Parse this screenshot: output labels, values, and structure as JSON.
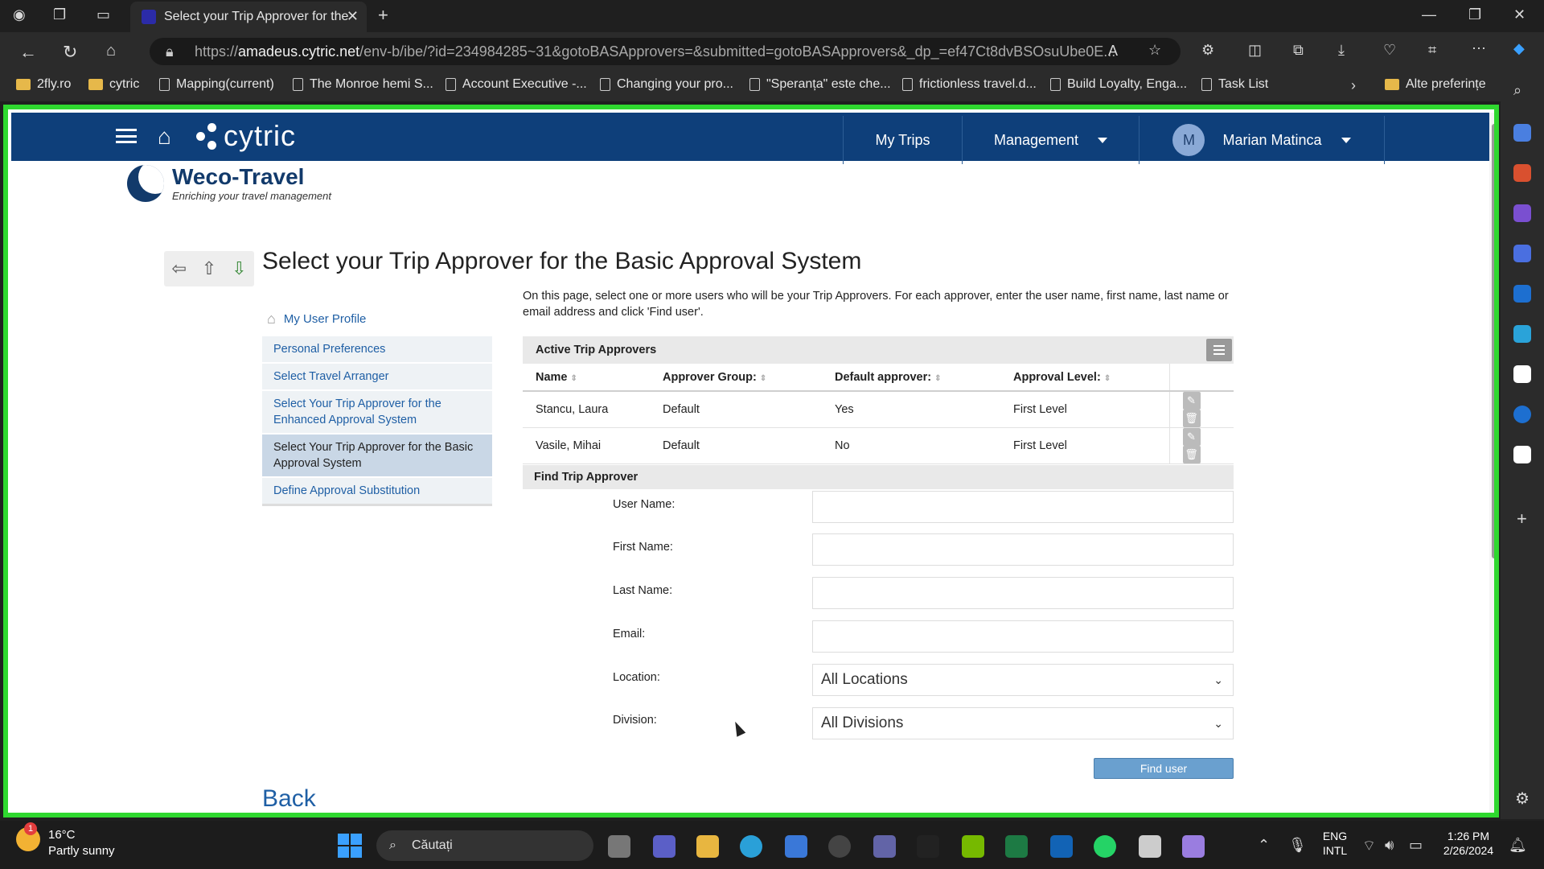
{
  "browser": {
    "tab_title": "Select your Trip Approver for the",
    "url_host": "amadeus.cytric.net",
    "url_rest": "/env-b/ibe/?id=234984285~31&gotoBASApprovers=&submitted=gotoBASApprovers&_dp_=ef47Ct8dvBSOsuUbe0E...",
    "url_prefix": "https://",
    "bookmarks": [
      "2fly.ro",
      "cytric",
      "Mapping(current)",
      "The Monroe hemi S...",
      "Account Executive -...",
      "Changing your pro...",
      "\"Speranța\" este che...",
      "frictionless travel.d...",
      "Build Loyalty, Enga...",
      "Task List",
      "Alte preferințe"
    ]
  },
  "header": {
    "brand": "cytric",
    "nav_my_trips": "My Trips",
    "nav_management": "Management",
    "user_initial": "M",
    "user_name": "Marian Matinca"
  },
  "logo": {
    "name": "Weco-Travel",
    "tagline": "Enriching your travel management"
  },
  "page": {
    "title": "Select your Trip Approver for the Basic Approval System",
    "intro": "On this page, select one or more users who will be your Trip Approvers. For each approver, enter the user name, first name, last name or email address and click 'Find user'.",
    "back": "Back"
  },
  "sidebar": {
    "home_link": "My User Profile",
    "items": [
      {
        "label": "Personal Preferences"
      },
      {
        "label": "Select Travel Arranger"
      },
      {
        "label": "Select Your Trip Approver for the Enhanced Approval System"
      },
      {
        "label": "Select Your Trip Approver for the Basic Approval System"
      },
      {
        "label": "Define Approval Substitution"
      }
    ]
  },
  "approvers": {
    "heading": "Active Trip Approvers",
    "columns": [
      "Name",
      "Approver Group:",
      "Default approver:",
      "Approval Level:"
    ],
    "rows": [
      {
        "name": "Stancu, Laura",
        "group": "Default",
        "default": "Yes",
        "level": "First Level"
      },
      {
        "name": "Vasile, Mihai",
        "group": "Default",
        "default": "No",
        "level": "First Level"
      }
    ]
  },
  "find": {
    "heading": "Find Trip Approver",
    "user_name_label": "User Name:",
    "first_name_label": "First Name:",
    "last_name_label": "Last Name:",
    "email_label": "Email:",
    "location_label": "Location:",
    "location_value": "All Locations",
    "division_label": "Division:",
    "division_value": "All Divisions",
    "button": "Find user"
  },
  "taskbar": {
    "temp": "16°C",
    "weather": "Partly sunny",
    "badge": "1",
    "search": "Căutați",
    "lang1": "ENG",
    "lang2": "INTL",
    "time": "1:26 PM",
    "date": "2/26/2024"
  },
  "colors": {
    "header": "#0e3f7a",
    "frame": "#2fd82f",
    "link": "#1f5fa5",
    "button": "#6aa0cf"
  }
}
